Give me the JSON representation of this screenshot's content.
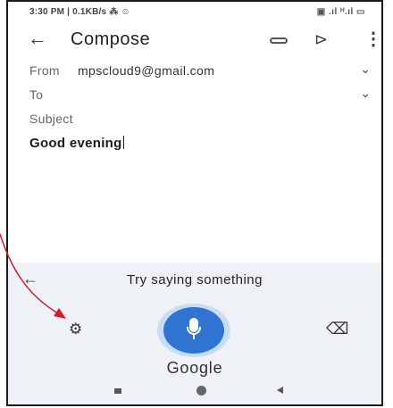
{
  "status_bar": {
    "left_text": "3:30 PM | 0.1KB/s ⁂ ☺",
    "right_text": "▣ .ıl ᴴ.ıl ▭"
  },
  "app_bar": {
    "back_icon": "arrow-left-icon",
    "title": "Compose",
    "attach_icon": "paperclip-icon",
    "send_icon": "send-icon",
    "more_icon": "more-vert-icon"
  },
  "compose": {
    "from_label": "From",
    "from_value": "mpscloud9@gmail.com",
    "to_label": "To",
    "subject_placeholder": "Subject",
    "body_text": "Good evening"
  },
  "voice_input": {
    "back_icon": "arrow-left-icon",
    "hint": "Try saying something",
    "settings_icon": "gear-icon",
    "mic_icon": "microphone-icon",
    "backspace_icon": "backspace-icon",
    "brand": "Google",
    "mic_color": "#2f74d0"
  },
  "annotation": {
    "arrow_color": "#d41a2a"
  }
}
